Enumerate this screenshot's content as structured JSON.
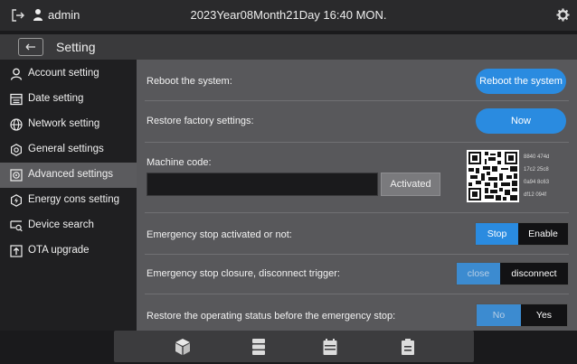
{
  "topbar": {
    "username": "admin",
    "datetime": "2023Year08Month21Day 16:40 MON."
  },
  "titlebar": {
    "title": "Setting"
  },
  "sidebar": {
    "items": [
      {
        "label": "Account setting",
        "icon": "user-icon"
      },
      {
        "label": "Date setting",
        "icon": "calendar-icon"
      },
      {
        "label": "Network setting",
        "icon": "globe-icon"
      },
      {
        "label": "General settings",
        "icon": "settings-icon"
      },
      {
        "label": "Advanced settings",
        "icon": "advanced-icon",
        "active": true
      },
      {
        "label": "Energy cons setting",
        "icon": "energy-icon"
      },
      {
        "label": "Device search",
        "icon": "device-search-icon"
      },
      {
        "label": "OTA upgrade",
        "icon": "upgrade-icon"
      }
    ]
  },
  "content": {
    "reboot": {
      "label": "Reboot the system:",
      "button": "Reboot the system"
    },
    "restore": {
      "label": "Restore factory settings:",
      "button": "Now"
    },
    "machine": {
      "label": "Machine code:",
      "value": "",
      "activated": "Activated",
      "codes": [
        "8840 474d",
        "17c2 25c8",
        "0a94 8c63",
        "df12 094f"
      ]
    },
    "estop": {
      "label": "Emergency stop activated or not:",
      "options": [
        "Stop",
        "Enable"
      ],
      "selected": "Stop"
    },
    "estop_closure": {
      "label": "Emergency stop closure, disconnect trigger:",
      "options": [
        "close",
        "disconnect"
      ],
      "selected": "close"
    },
    "restore_status": {
      "label": "Restore the operating status before the emergency stop:",
      "options": [
        "No",
        "Yes"
      ],
      "selected": "No"
    }
  },
  "bottombar": {
    "icons": [
      "cube-icon",
      "server-icon",
      "calendar-icon",
      "clipboard-icon"
    ]
  },
  "colors": {
    "accent": "#2a8be0",
    "panel": "#58585b",
    "sidebar": "#1f1f21"
  }
}
